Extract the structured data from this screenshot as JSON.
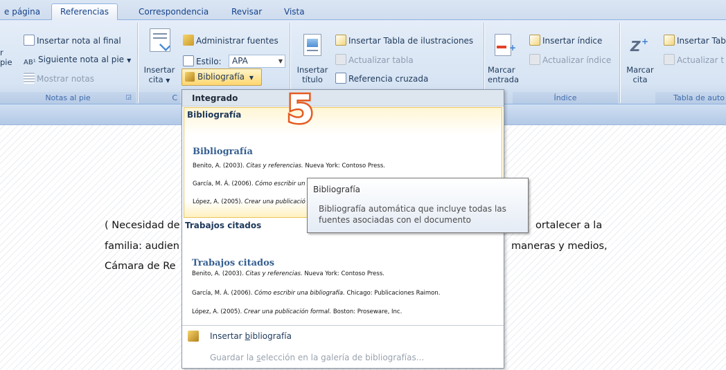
{
  "tabs": [
    {
      "label": "e página"
    },
    {
      "label": "Referencias"
    },
    {
      "label": "Correspondencia"
    },
    {
      "label": "Revisar"
    },
    {
      "label": "Vista"
    }
  ],
  "ribbon": {
    "footnotes": {
      "insert_endnote": "Insertar nota al final",
      "next_footnote": "Siguiente nota al pie",
      "show_notes": "Mostrar notas",
      "left_edge_line1": "r",
      "left_edge_line2": "pie",
      "group_label": "Notas al pie"
    },
    "citations": {
      "insert_citation_line1": "Insertar",
      "insert_citation_line2": "cita",
      "manage_sources": "Administrar fuentes",
      "style_label": "Estilo:",
      "style_value": "APA",
      "bibliography_button": "Bibliografía",
      "group_label_partial": "C"
    },
    "captions": {
      "insert_caption_line1": "Insertar",
      "insert_caption_line2": "título",
      "insert_table_of_figures": "Insertar Tabla de ilustraciones",
      "update_table": "Actualizar tabla",
      "cross_reference": "Referencia cruzada"
    },
    "index": {
      "mark_entry_line1": "Marcar",
      "mark_entry_line2": "entrada",
      "insert_index": "Insertar índice",
      "update_index": "Actualizar índice",
      "group_label": "Índice"
    },
    "toa": {
      "mark_citation_line1": "Marcar",
      "mark_citation_line2": "cita",
      "insert_table": "Insertar Tab",
      "update_table": "Actualizar t",
      "group_label": "Tabla de auto"
    }
  },
  "document": {
    "line1_start": "( Necesidad de",
    "line1_end": "ortalecer a la",
    "line2_start": "familia: audien",
    "line2_end": "maneras y medios,",
    "line3_start": "Cámara de Re"
  },
  "dropdown": {
    "header": "Integrado",
    "items": [
      {
        "label": "Bibliografía",
        "preview_title": "Bibliografía",
        "entries": [
          {
            "author": "Benito, A. (2003). ",
            "title": "Citas y referencias.",
            "rest": " Nueva York: Contoso Press."
          },
          {
            "author": "García, M. Á. (2006). ",
            "title": "Cómo escribir un",
            "rest": ""
          },
          {
            "author": "López, A. (2005). ",
            "title": "Crear una publicació",
            "rest": ""
          }
        ]
      },
      {
        "label": "Trabajos citados",
        "preview_title": "Trabajos citados",
        "entries": [
          {
            "author": "Benito, A. (2003). ",
            "title": "Citas y referencias.",
            "rest": " Nueva York: Contoso Press."
          },
          {
            "author": "García, M. Á. (2006). ",
            "title": "Cómo escribir una bibliografía.",
            "rest": " Chicago: Publicaciones Raimon."
          },
          {
            "author": "López, A. (2005). ",
            "title": "Crear una publicación formal.",
            "rest": " Boston: Proseware, Inc."
          }
        ]
      }
    ],
    "insert_bibliography_pre": "Insertar ",
    "insert_bibliography_u": "b",
    "insert_bibliography_post": "ibliografía",
    "save_selection_pre": "Guardar la ",
    "save_selection_u": "s",
    "save_selection_post": "elección en la galería de bibliografías..."
  },
  "tooltip": {
    "title": "Bibliografía",
    "body": "Bibliografía automática que incluye todas las fuentes asociadas con el documento"
  },
  "step_marker": "5",
  "colors": {
    "ribbon_bg": "#dbe6f4",
    "accent_text": "#15428b",
    "highlight": "#ffd66e",
    "step_orange": "#e55a1f"
  }
}
